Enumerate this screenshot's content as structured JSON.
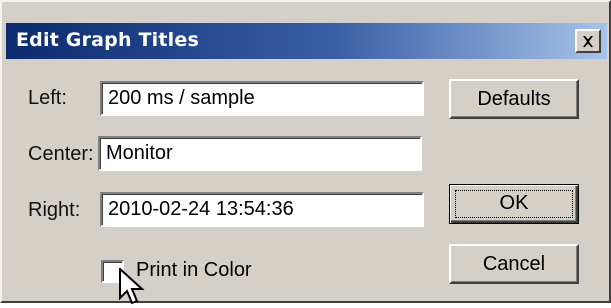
{
  "window": {
    "title": "Edit Graph Titles",
    "close_symbol": "×"
  },
  "fields": {
    "left": {
      "label": "Left:",
      "value": "200 ms / sample"
    },
    "center": {
      "label": "Center:",
      "value": "Monitor"
    },
    "right": {
      "label": "Right:",
      "value": "2010-02-24 13:54:36"
    }
  },
  "checkbox": {
    "label": "Print in Color",
    "checked": false
  },
  "buttons": {
    "defaults": "Defaults",
    "ok": "OK",
    "cancel": "Cancel"
  },
  "icons": {
    "close": "close-icon",
    "cursor": "mouse-pointer-icon"
  },
  "colors": {
    "face": "#d4d0c8",
    "title_start": "#0b2a6f",
    "title_end": "#a6c4ea"
  }
}
